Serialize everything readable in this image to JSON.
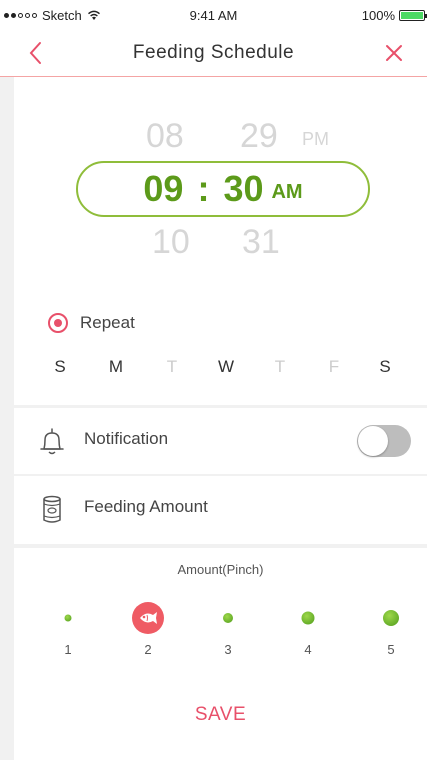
{
  "status_bar": {
    "carrier": "Sketch",
    "time": "9:41 AM",
    "battery": "100%"
  },
  "nav": {
    "title": "Feeding Schedule"
  },
  "picker": {
    "prev": {
      "hour": "08",
      "minute": "29",
      "ampm": "PM"
    },
    "selected": {
      "hour": "09",
      "separator": ":",
      "minute": "30",
      "ampm": "AM"
    },
    "next": {
      "hour": "10",
      "minute": "31"
    }
  },
  "repeat": {
    "label": "Repeat",
    "checked": true
  },
  "days": [
    {
      "letter": "S",
      "active": true
    },
    {
      "letter": "M",
      "active": true
    },
    {
      "letter": "T",
      "active": false
    },
    {
      "letter": "W",
      "active": true
    },
    {
      "letter": "T",
      "active": false
    },
    {
      "letter": "F",
      "active": false
    },
    {
      "letter": "S",
      "active": true
    }
  ],
  "notification": {
    "label": "Notification",
    "icon": "bell-icon",
    "enabled": false
  },
  "feeding_amount": {
    "label": "Feeding Amount",
    "icon": "can-icon"
  },
  "amount": {
    "title": "Amount(Pinch)",
    "levels": [
      "1",
      "2",
      "3",
      "4",
      "5"
    ],
    "selected": 2
  },
  "save_label": "SAVE",
  "colors": {
    "accent": "#e8506a",
    "green": "#5c9a1a",
    "toggle_off": "#bdbdbd"
  }
}
